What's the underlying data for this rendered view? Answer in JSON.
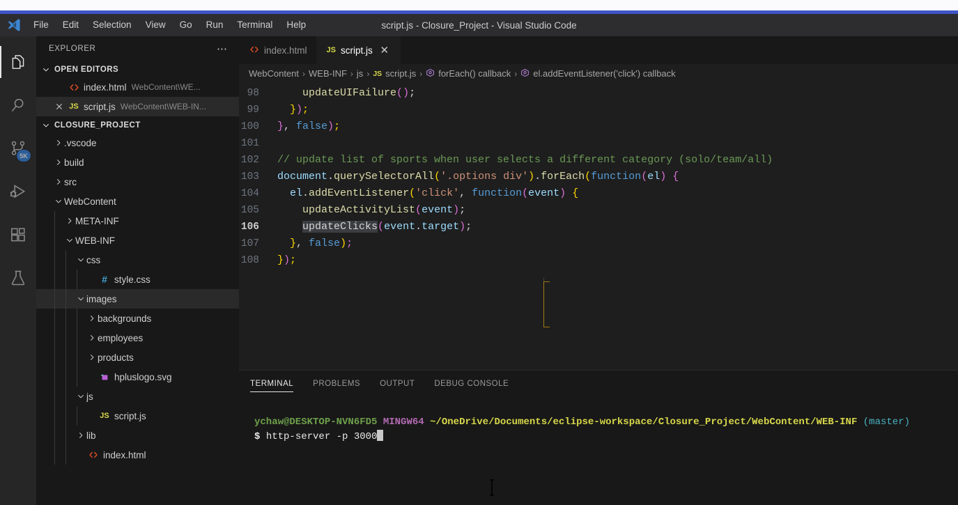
{
  "window": {
    "title": "script.js - Closure_Project - Visual Studio Code",
    "logo_icon": "vscode-logo-icon"
  },
  "menubar": {
    "items": [
      {
        "label": "File"
      },
      {
        "label": "Edit"
      },
      {
        "label": "Selection"
      },
      {
        "label": "View"
      },
      {
        "label": "Go"
      },
      {
        "label": "Run"
      },
      {
        "label": "Terminal"
      },
      {
        "label": "Help"
      }
    ]
  },
  "activitybar": {
    "items": [
      {
        "name": "explorer",
        "icon": "files-icon",
        "active": true,
        "badge": ""
      },
      {
        "name": "search",
        "icon": "search-icon",
        "active": false,
        "badge": ""
      },
      {
        "name": "source-control",
        "icon": "source-control-icon",
        "active": false,
        "badge": "5K"
      },
      {
        "name": "run-and-debug",
        "icon": "run-debug-icon",
        "active": false,
        "badge": ""
      },
      {
        "name": "extensions",
        "icon": "extensions-icon",
        "active": false,
        "badge": ""
      },
      {
        "name": "testing",
        "icon": "beaker-icon",
        "active": false,
        "badge": ""
      }
    ]
  },
  "sidebar": {
    "title": "EXPLORER",
    "actions_icon": "ellipsis-icon",
    "open_editors": {
      "label": "OPEN EDITORS",
      "expanded": true,
      "items": [
        {
          "name": "index.html",
          "description": "WebContent\\WE...",
          "icon": "html-icon",
          "selected": false,
          "closable": false
        },
        {
          "name": "script.js",
          "description": "WebContent\\WEB-IN...",
          "icon": "js-icon",
          "selected": true,
          "closable": true
        }
      ]
    },
    "project": {
      "label": "CLOSURE_PROJECT",
      "expanded": true,
      "tree": [
        {
          "label": ".vscode",
          "depth": 1,
          "type": "folder",
          "expanded": false,
          "icon": "chevron-right-icon"
        },
        {
          "label": "build",
          "depth": 1,
          "type": "folder",
          "expanded": false,
          "icon": "chevron-right-icon"
        },
        {
          "label": "src",
          "depth": 1,
          "type": "folder",
          "expanded": false,
          "icon": "chevron-right-icon"
        },
        {
          "label": "WebContent",
          "depth": 1,
          "type": "folder",
          "expanded": true,
          "icon": "chevron-down-icon"
        },
        {
          "label": "META-INF",
          "depth": 2,
          "type": "folder",
          "expanded": false,
          "icon": "chevron-right-icon"
        },
        {
          "label": "WEB-INF",
          "depth": 2,
          "type": "folder",
          "expanded": true,
          "icon": "chevron-down-icon"
        },
        {
          "label": "css",
          "depth": 3,
          "type": "folder",
          "expanded": true,
          "icon": "chevron-down-icon"
        },
        {
          "label": "style.css",
          "depth": 4,
          "type": "file",
          "icon": "css-icon"
        },
        {
          "label": "images",
          "depth": 3,
          "type": "folder",
          "expanded": true,
          "icon": "chevron-down-icon",
          "selected": true
        },
        {
          "label": "backgrounds",
          "depth": 4,
          "type": "folder",
          "expanded": false,
          "icon": "chevron-right-icon"
        },
        {
          "label": "employees",
          "depth": 4,
          "type": "folder",
          "expanded": false,
          "icon": "chevron-right-icon"
        },
        {
          "label": "products",
          "depth": 4,
          "type": "folder",
          "expanded": false,
          "icon": "chevron-right-icon"
        },
        {
          "label": "hpluslogo.svg",
          "depth": 4,
          "type": "file",
          "icon": "svg-icon"
        },
        {
          "label": "js",
          "depth": 3,
          "type": "folder",
          "expanded": true,
          "icon": "chevron-down-icon"
        },
        {
          "label": "script.js",
          "depth": 4,
          "type": "file",
          "icon": "js-icon"
        },
        {
          "label": "lib",
          "depth": 3,
          "type": "folder",
          "expanded": false,
          "icon": "chevron-right-icon"
        },
        {
          "label": "index.html",
          "depth": 3,
          "type": "file",
          "icon": "html-icon"
        }
      ]
    }
  },
  "editor": {
    "tabs": [
      {
        "label": "index.html",
        "icon": "html-icon",
        "active": false,
        "close_icon": ""
      },
      {
        "label": "script.js",
        "icon": "js-icon",
        "active": true,
        "close_icon": "✕"
      }
    ],
    "breadcrumbs": [
      {
        "label": "WebContent",
        "icon": ""
      },
      {
        "label": "WEB-INF",
        "icon": ""
      },
      {
        "label": "js",
        "icon": ""
      },
      {
        "label": "script.js",
        "icon": "js-icon"
      },
      {
        "label": "forEach() callback",
        "icon": "symbol-method-icon"
      },
      {
        "label": "el.addEventListener('click') callback",
        "icon": "symbol-method-icon"
      }
    ],
    "breadcrumb_separator": "›",
    "first_line_number": 98,
    "current_line": 106,
    "lines": [
      {
        "n": 98,
        "text": "    updateUIFailure();"
      },
      {
        "n": 99,
        "text": "  });"
      },
      {
        "n": 100,
        "text": "}, false);"
      },
      {
        "n": 101,
        "text": ""
      },
      {
        "n": 102,
        "text": "// update list of sports when user selects a different category (solo/team/all)"
      },
      {
        "n": 103,
        "text": "document.querySelectorAll('.options div').forEach(function(el) {"
      },
      {
        "n": 104,
        "text": "  el.addEventListener('click', function(event) {"
      },
      {
        "n": 105,
        "text": "    updateActivityList(event);"
      },
      {
        "n": 106,
        "text": "    updateClicks(event.target);"
      },
      {
        "n": 107,
        "text": "  }, false);"
      },
      {
        "n": 108,
        "text": "});"
      }
    ]
  },
  "panel": {
    "tabs": [
      {
        "label": "TERMINAL",
        "active": true
      },
      {
        "label": "PROBLEMS",
        "active": false
      },
      {
        "label": "OUTPUT",
        "active": false
      },
      {
        "label": "DEBUG CONSOLE",
        "active": false
      }
    ],
    "terminal": {
      "user": "ychaw@DESKTOP-NVN6FD5",
      "shell": "MINGW64",
      "path": "~/OneDrive/Documents/eclipse-workspace/Closure_Project/WebContent/WEB-INF",
      "branch": "(master)",
      "prompt": "$",
      "command": "http-server -p 3000"
    }
  },
  "colors": {
    "accent_blue": "#4055c8",
    "badge_blue": "#2f7fe0",
    "editor_bg": "#1e1e1e",
    "sidebar_bg": "#181818",
    "titlebar_bg": "#2d2d30"
  }
}
